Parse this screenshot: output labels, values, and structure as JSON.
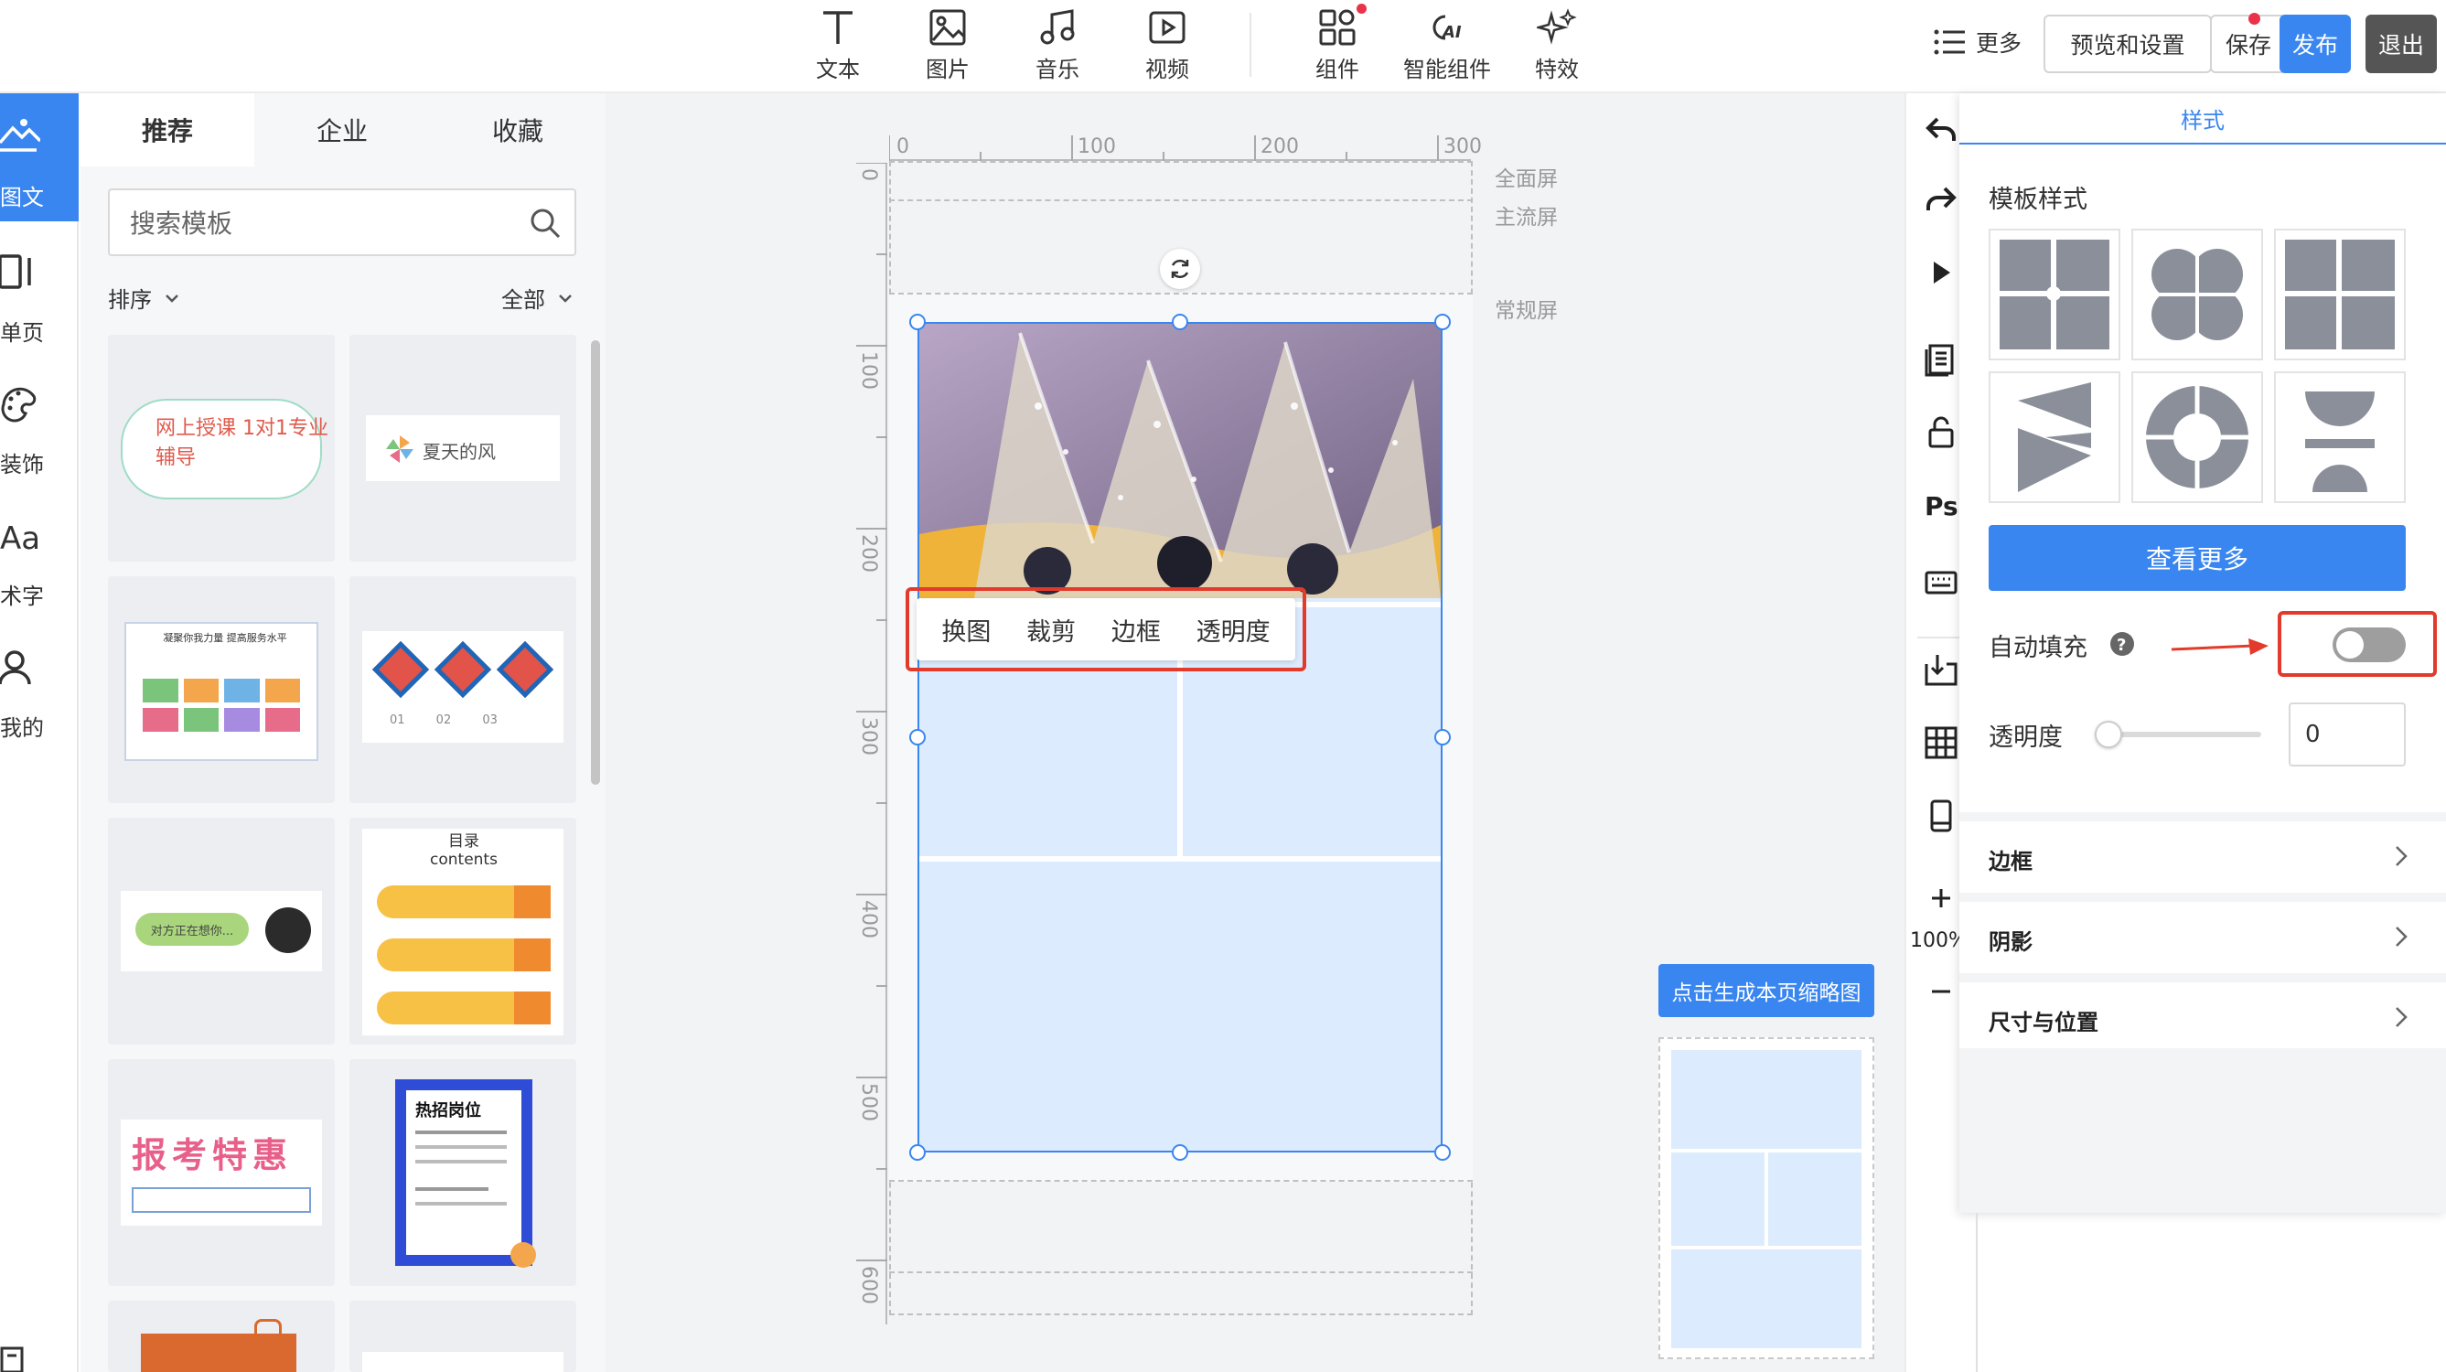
{
  "toolbar": {
    "tools": [
      {
        "label": "文本",
        "icon": "text-icon"
      },
      {
        "label": "图片",
        "icon": "image-icon"
      },
      {
        "label": "音乐",
        "icon": "music-icon"
      },
      {
        "label": "视频",
        "icon": "video-icon"
      },
      {
        "label": "组件",
        "icon": "components-icon"
      },
      {
        "label": "智能组件",
        "icon": "ai-components-icon"
      },
      {
        "label": "特效",
        "icon": "effects-icon"
      }
    ],
    "more_label": "更多",
    "preview_label": "预览和设置",
    "save_label": "保存",
    "publish_label": "发布",
    "exit_label": "退出"
  },
  "rail": {
    "items": [
      {
        "label": "图文",
        "icon": "graphic-text-icon",
        "active": true
      },
      {
        "label": "单页",
        "icon": "single-page-icon"
      },
      {
        "label": "装饰",
        "icon": "palette-icon"
      },
      {
        "label": "术字",
        "icon": "art-text-icon"
      },
      {
        "label": "我的",
        "icon": "user-icon"
      }
    ]
  },
  "panel": {
    "tabs": [
      "推荐",
      "企业",
      "收藏"
    ],
    "search_placeholder": "搜索模板",
    "sort_label": "排序",
    "filter_label": "全部",
    "cards": [
      {
        "text": "网上授课 1对1专业辅导"
      },
      {
        "text": "夏天的风"
      },
      {
        "text": "凝聚你我力量 提高服务水平"
      },
      {
        "text": "01 02 03"
      },
      {
        "text": "对方正在想你..."
      },
      {
        "text": "目录 contents"
      },
      {
        "text": "报考特惠"
      },
      {
        "text": "热招岗位"
      }
    ]
  },
  "canvas": {
    "ruler_top": [
      "0",
      "100",
      "200",
      "300"
    ],
    "ruler_left": [
      "0",
      "100",
      "200",
      "300",
      "400",
      "500",
      "600"
    ],
    "screen_labels": [
      "全面屏",
      "主流屏",
      "常规屏"
    ],
    "context_menu": [
      "换图",
      "裁剪",
      "边框",
      "透明度"
    ],
    "thumbnail_button": "点击生成本页缩略图"
  },
  "rightstrip": {
    "zoom": "100%"
  },
  "props": {
    "tab": "样式",
    "section_title": "模板样式",
    "more_button": "查看更多",
    "auto_fill_label": "自动填充",
    "auto_fill_on": false,
    "opacity_label": "透明度",
    "opacity_value": "0",
    "sections": [
      "边框",
      "阴影",
      "尺寸与位置"
    ]
  },
  "colors": {
    "accent": "#3a86f0",
    "highlight": "#e23a2b",
    "canvas_fill": "#dcebfd"
  }
}
